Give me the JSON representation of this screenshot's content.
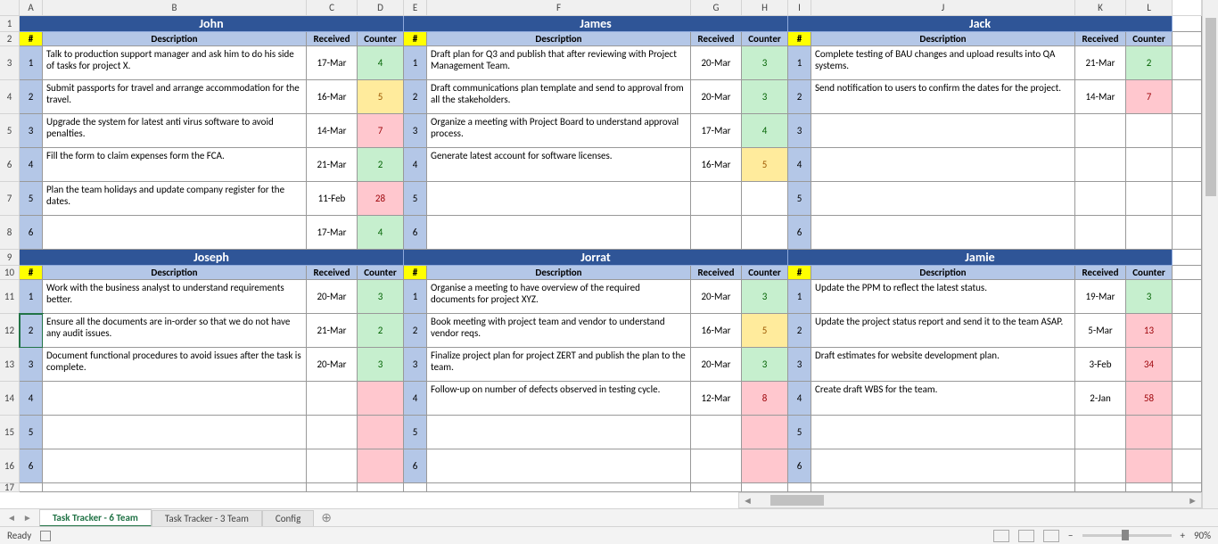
{
  "columns": [
    "A",
    "B",
    "C",
    "D",
    "E",
    "F",
    "G",
    "H",
    "I",
    "J",
    "K",
    "L"
  ],
  "rows": [
    1,
    2,
    3,
    4,
    5,
    6,
    7,
    8,
    9,
    10,
    11,
    12,
    13,
    14,
    15,
    16,
    17
  ],
  "labels": {
    "num": "#",
    "description": "Description",
    "received": "Received",
    "counter": "Counter"
  },
  "people_top": [
    {
      "name": "John",
      "tasks": [
        {
          "n": "1",
          "desc": "Talk to production support manager and ask him to do his side of tasks for project X.",
          "recv": "17-Mar",
          "ctr": "4",
          "cls": "ctr-green"
        },
        {
          "n": "2",
          "desc": "Submit passports for travel and arrange accommodation for the travel.",
          "recv": "16-Mar",
          "ctr": "5",
          "cls": "ctr-yellow"
        },
        {
          "n": "3",
          "desc": "Upgrade the system for latest anti virus software to avoid penalties.",
          "recv": "14-Mar",
          "ctr": "7",
          "cls": "ctr-red"
        },
        {
          "n": "4",
          "desc": "Fill the form to claim expenses form the FCA.",
          "recv": "21-Mar",
          "ctr": "2",
          "cls": "ctr-green"
        },
        {
          "n": "5",
          "desc": "Plan the team holidays and update company register for the dates.",
          "recv": "11-Feb",
          "ctr": "28",
          "cls": "ctr-red"
        },
        {
          "n": "6",
          "desc": "",
          "recv": "17-Mar",
          "ctr": "4",
          "cls": "ctr-green"
        }
      ]
    },
    {
      "name": "James",
      "tasks": [
        {
          "n": "1",
          "desc": "Draft plan for Q3 and publish that after reviewing with Project Management Team.",
          "recv": "20-Mar",
          "ctr": "3",
          "cls": "ctr-green"
        },
        {
          "n": "2",
          "desc": "Draft communications plan template and send to approval from all the stakeholders.",
          "recv": "20-Mar",
          "ctr": "3",
          "cls": "ctr-green"
        },
        {
          "n": "3",
          "desc": "Organize a meeting with Project Board to understand approval process.",
          "recv": "17-Mar",
          "ctr": "4",
          "cls": "ctr-green"
        },
        {
          "n": "4",
          "desc": "Generate latest account for software licenses.",
          "recv": "16-Mar",
          "ctr": "5",
          "cls": "ctr-yellow"
        },
        {
          "n": "5",
          "desc": "",
          "recv": "",
          "ctr": "",
          "cls": ""
        },
        {
          "n": "6",
          "desc": "",
          "recv": "",
          "ctr": "",
          "cls": ""
        }
      ]
    },
    {
      "name": "Jack",
      "tasks": [
        {
          "n": "1",
          "desc": "Complete testing of BAU changes and upload results into QA systems.",
          "recv": "21-Mar",
          "ctr": "2",
          "cls": "ctr-green"
        },
        {
          "n": "2",
          "desc": "Send notification to users to confirm the dates for the project.",
          "recv": "14-Mar",
          "ctr": "7",
          "cls": "ctr-red"
        },
        {
          "n": "3",
          "desc": "",
          "recv": "",
          "ctr": "",
          "cls": ""
        },
        {
          "n": "4",
          "desc": "",
          "recv": "",
          "ctr": "",
          "cls": ""
        },
        {
          "n": "5",
          "desc": "",
          "recv": "",
          "ctr": "",
          "cls": ""
        },
        {
          "n": "6",
          "desc": "",
          "recv": "",
          "ctr": "",
          "cls": ""
        }
      ]
    }
  ],
  "people_bot": [
    {
      "name": "Joseph",
      "tasks": [
        {
          "n": "1",
          "desc": "Work with the business analyst to understand requirements better.",
          "recv": "20-Mar",
          "ctr": "3",
          "cls": "ctr-green"
        },
        {
          "n": "2",
          "desc": "Ensure all the documents are in-order so that we do not have any audit issues.",
          "recv": "21-Mar",
          "ctr": "2",
          "cls": "ctr-green"
        },
        {
          "n": "3",
          "desc": "Document functional procedures to avoid issues after the task is complete.",
          "recv": "20-Mar",
          "ctr": "3",
          "cls": "ctr-green"
        },
        {
          "n": "4",
          "desc": "",
          "recv": "",
          "ctr": "",
          "cls": "ctr-red"
        },
        {
          "n": "5",
          "desc": "",
          "recv": "",
          "ctr": "",
          "cls": "ctr-red"
        },
        {
          "n": "6",
          "desc": "",
          "recv": "",
          "ctr": "",
          "cls": "ctr-red"
        }
      ]
    },
    {
      "name": "Jorrat",
      "tasks": [
        {
          "n": "1",
          "desc": "Organise a meeting to have overview of the required documents for project XYZ.",
          "recv": "20-Mar",
          "ctr": "3",
          "cls": "ctr-green"
        },
        {
          "n": "2",
          "desc": "Book meeting with project team and vendor to understand vendor reqs.",
          "recv": "16-Mar",
          "ctr": "5",
          "cls": "ctr-yellow"
        },
        {
          "n": "3",
          "desc": "Finalize project plan for project ZERT and publish the plan to the team.",
          "recv": "20-Mar",
          "ctr": "3",
          "cls": "ctr-green"
        },
        {
          "n": "4",
          "desc": "Follow-up on number of defects observed in testing cycle.",
          "recv": "12-Mar",
          "ctr": "8",
          "cls": "ctr-red"
        },
        {
          "n": "5",
          "desc": "",
          "recv": "",
          "ctr": "",
          "cls": "ctr-red"
        },
        {
          "n": "6",
          "desc": "",
          "recv": "",
          "ctr": "",
          "cls": "ctr-red"
        }
      ]
    },
    {
      "name": "Jamie",
      "tasks": [
        {
          "n": "1",
          "desc": "Update the PPM to reflect the latest status.",
          "recv": "19-Mar",
          "ctr": "3",
          "cls": "ctr-green"
        },
        {
          "n": "2",
          "desc": "Update the project status report and send it to the team ASAP.",
          "recv": "5-Mar",
          "ctr": "13",
          "cls": "ctr-red"
        },
        {
          "n": "3",
          "desc": "Draft estimates for website development plan.",
          "recv": "3-Feb",
          "ctr": "34",
          "cls": "ctr-red"
        },
        {
          "n": "4",
          "desc": "Create draft WBS for the team.",
          "recv": "2-Jan",
          "ctr": "58",
          "cls": "ctr-red"
        },
        {
          "n": "5",
          "desc": "",
          "recv": "",
          "ctr": "",
          "cls": "ctr-red"
        },
        {
          "n": "6",
          "desc": "",
          "recv": "",
          "ctr": "",
          "cls": "ctr-red"
        }
      ]
    }
  ],
  "tabs": [
    "Task Tracker - 6 Team",
    "Task Tracker  - 3 Team",
    "Config"
  ],
  "status": {
    "ready": "Ready",
    "zoom": "90%"
  }
}
